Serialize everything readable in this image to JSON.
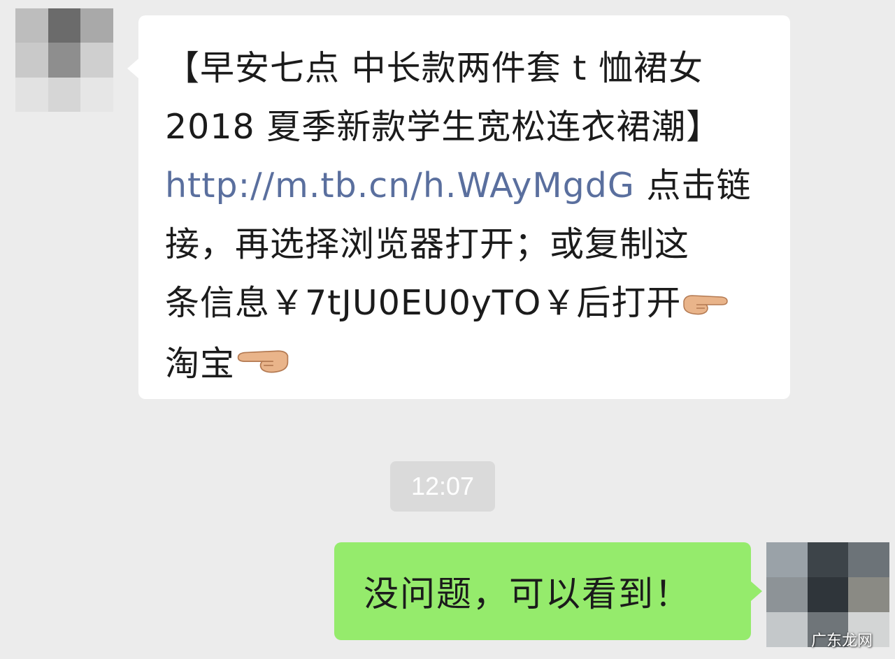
{
  "incoming_message": {
    "line1": "【早安七点 中长款两件套 t 恤裙女",
    "line2": "2018 夏季新款学生宽松连衣裙潮】",
    "link": "http://m.tb.cn/h.WAyMgdG",
    "line3_rest": " 点击链",
    "line4": "接，再选择浏览器打开；或复制这",
    "line5": "条信息￥7tJU0EU0yTO￥后打开",
    "line6": "淘宝",
    "emoji_1": "pointing-right-hand-icon",
    "emoji_2": "pointing-right-hand-icon"
  },
  "timestamp": "12:07",
  "outgoing_message": {
    "text": "没问题，可以看到！"
  },
  "watermark": "广东龙网",
  "colors": {
    "background": "#ececec",
    "incoming_bubble": "#ffffff",
    "outgoing_bubble": "#95eb6c",
    "link": "#5a6f9e",
    "timestamp_bg": "#dadada"
  }
}
